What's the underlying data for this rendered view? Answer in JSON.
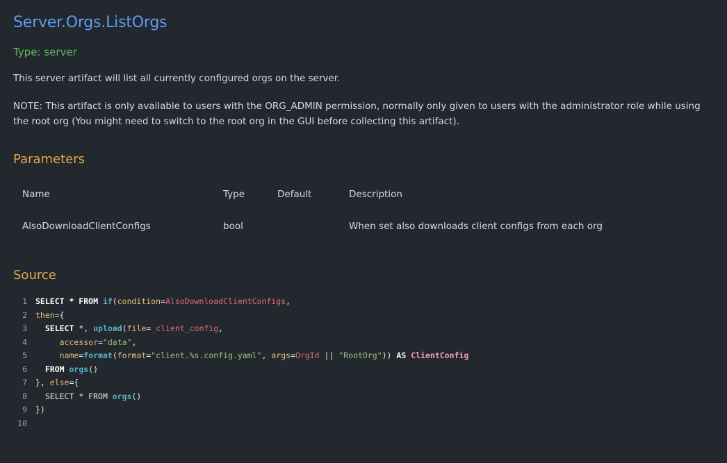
{
  "artifact": {
    "title": "Server.Orgs.ListOrgs",
    "type_line": "Type: server",
    "description": "This server artifact will list all currently configured orgs on the server.",
    "note": "NOTE: This artifact is only available to users with the ORG_ADMIN permission, normally only given to users with the administrator role while using the root org (You might need to switch to the root org in the GUI before collecting this artifact)."
  },
  "parameters": {
    "heading": "Parameters",
    "columns": {
      "name": "Name",
      "type": "Type",
      "default": "Default",
      "description": "Description"
    },
    "rows": [
      {
        "name": "AlsoDownloadClientConfigs",
        "type": "bool",
        "default": "",
        "description": "When set also downloads client configs from each org"
      }
    ]
  },
  "source": {
    "heading": "Source",
    "line_numbers": [
      "1",
      "2",
      "3",
      "4",
      "5",
      "6",
      "7",
      "8",
      "9",
      "10"
    ],
    "tokens": {
      "l1_select": "SELECT * FROM ",
      "l1_if": "if",
      "l1_open": "(",
      "l1_cond": "condition",
      "l1_eq": "=",
      "l1_param": "AlsoDownloadClientConfigs",
      "l1_comma": ",",
      "l2_then": "then",
      "l2_rest": "={",
      "l3_indent": "  ",
      "l3_select": "SELECT",
      "l3_star": " *, ",
      "l3_upload": "upload",
      "l3_open": "(",
      "l3_file": "file",
      "l3_eq": "=",
      "l3_val": "_client_config",
      "l3_comma": ",",
      "l4_indent": "     ",
      "l4_acc": "accessor",
      "l4_eq": "=",
      "l4_str": "\"data\"",
      "l4_comma": ",",
      "l5_indent": "     ",
      "l5_name": "name",
      "l5_eq": "=",
      "l5_format": "format",
      "l5_open": "(",
      "l5_fmt": "format",
      "l5_eq2": "=",
      "l5_str": "\"client.%s.config.yaml\"",
      "l5_sep": ", ",
      "l5_args": "args",
      "l5_eq3": "=",
      "l5_orgid": "OrgId",
      "l5_or": " || ",
      "l5_str2": "\"RootOrg\"",
      "l5_close": ")) ",
      "l5_as": "AS",
      "l5_sp": " ",
      "l5_alias": "ClientConfig",
      "l6_indent": "  ",
      "l6_from": "FROM ",
      "l6_orgs": "orgs",
      "l6_paren": "()",
      "l7_close": "}, ",
      "l7_else": "else",
      "l7_rest": "={",
      "l8_indent": "  ",
      "l8_select": "SELECT * FROM ",
      "l8_orgs": "orgs",
      "l8_paren": "()",
      "l9_close": "})",
      "l10": ""
    }
  },
  "colors": {
    "background": "#23272e",
    "title": "#5d9cf2",
    "type": "#5cb85c",
    "heading": "#e2a84b"
  }
}
